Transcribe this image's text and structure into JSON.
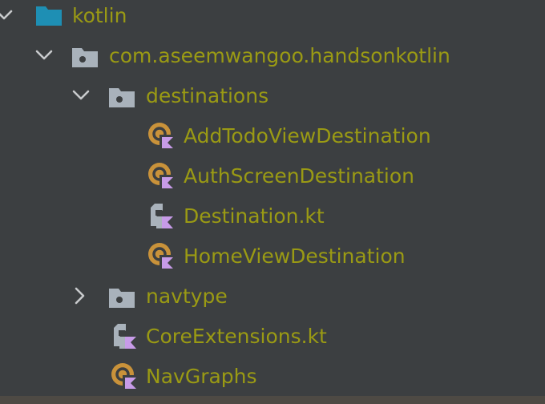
{
  "colors": {
    "background": "#3c3f41",
    "label": "#9a9a14",
    "chevron": "#c8cacc",
    "root_folder": "#1e8fb4",
    "package_folder": "#a9b2bb",
    "class_circle": "#c9923a",
    "kotlin_badge": "#c79be8",
    "file_icon": "#a9b2bb"
  },
  "tree": {
    "root": {
      "label": "kotlin",
      "expanded": true,
      "icon": "source-root-folder-icon"
    },
    "package": {
      "label": "com.aseemwangoo.handsonkotlin",
      "expanded": true,
      "icon": "package-folder-icon"
    },
    "destinations": {
      "label": "destinations",
      "expanded": true,
      "icon": "package-folder-icon",
      "children": [
        {
          "label": "AddTodoViewDestination",
          "icon": "kotlin-class-icon"
        },
        {
          "label": "AuthScreenDestination",
          "icon": "kotlin-class-icon"
        },
        {
          "label": "Destination.kt",
          "icon": "kotlin-file-icon"
        },
        {
          "label": "HomeViewDestination",
          "icon": "kotlin-class-icon"
        }
      ]
    },
    "navtype": {
      "label": "navtype",
      "expanded": false,
      "icon": "package-folder-icon"
    },
    "core_extensions": {
      "label": "CoreExtensions.kt",
      "icon": "kotlin-file-icon"
    },
    "nav_graphs": {
      "label": "NavGraphs",
      "icon": "kotlin-class-icon"
    }
  }
}
